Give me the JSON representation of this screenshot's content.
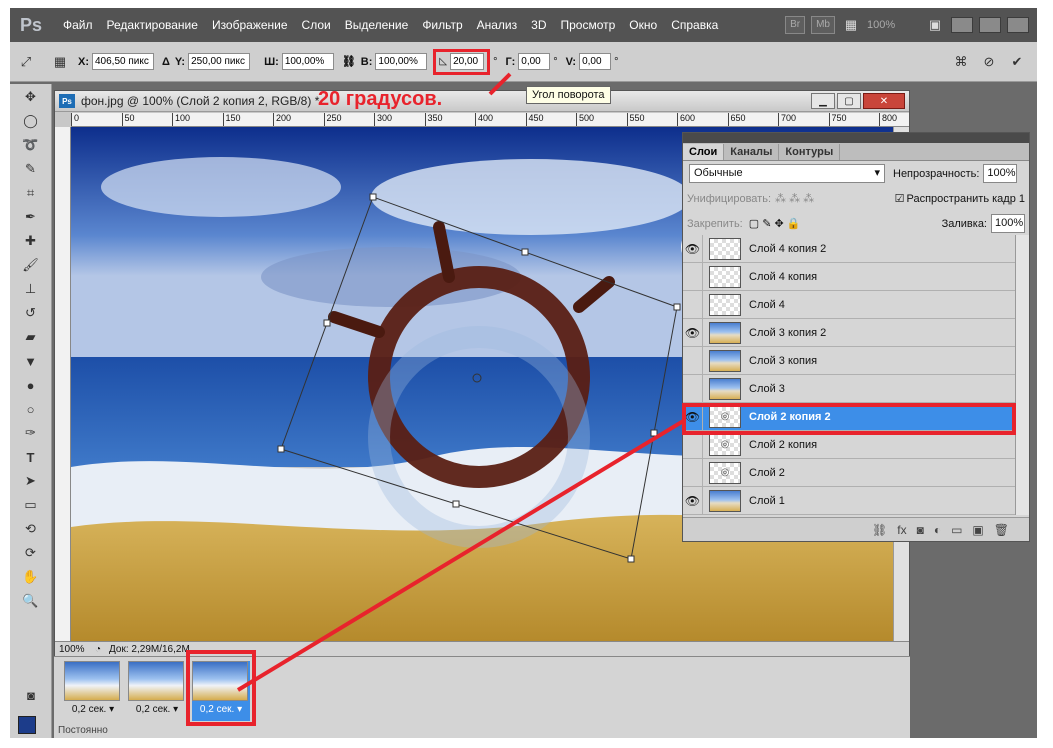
{
  "app": {
    "logo": "Ps"
  },
  "menu": [
    "Файл",
    "Редактирование",
    "Изображение",
    "Слои",
    "Выделение",
    "Фильтр",
    "Анализ",
    "3D",
    "Просмотр",
    "Окно",
    "Справка"
  ],
  "menu_right": {
    "br_label": "Br",
    "mb_label": "Mb",
    "zoom": "100%"
  },
  "options": {
    "x_label": "X:",
    "x_value": "406,50 пикс",
    "y_label": "Y:",
    "y_value": "250,00 пикс",
    "w_label": "Ш:",
    "w_value": "100,00%",
    "h_label": "В:",
    "h_value": "100,00%",
    "angle_value": "20,00",
    "angle_unit": "°",
    "hskew_label": "Г:",
    "hskew_value": "0,00",
    "vskew_label": "V:",
    "vskew_value": "0,00"
  },
  "tooltip": "Угол поворота",
  "annotation": "20 градусов.",
  "document": {
    "title": "фон.jpg @ 100% (Слой 2 копия 2, RGB/8) *",
    "zoom": "100%",
    "status": "Док: 2,29M/16,2M",
    "ruler_marks": [
      "0",
      "50",
      "100",
      "150",
      "200",
      "250",
      "300",
      "350",
      "400",
      "450",
      "500",
      "550",
      "600",
      "650",
      "700",
      "750",
      "800"
    ]
  },
  "animation": {
    "frames": [
      {
        "delay": "0,2 сек.",
        "selected": false
      },
      {
        "delay": "0,2 сек.",
        "selected": false
      },
      {
        "delay": "0,2 сек.",
        "selected": true
      }
    ],
    "loop": "Постоянно"
  },
  "layers_panel": {
    "tabs": [
      "Слои",
      "Каналы",
      "Контуры"
    ],
    "blend_mode": "Обычные",
    "opacity_label": "Непрозрачность:",
    "opacity_value": "100%",
    "unify_label": "Унифицировать:",
    "propagate_label": "Распространить кадр 1",
    "lock_label": "Закрепить:",
    "fill_label": "Заливка:",
    "fill_value": "100%",
    "layers": [
      {
        "name": "Слой 4 копия 2",
        "visible": true,
        "thumb": "transparent",
        "selected": false
      },
      {
        "name": "Слой 4 копия",
        "visible": false,
        "thumb": "transparent",
        "selected": false
      },
      {
        "name": "Слой 4",
        "visible": false,
        "thumb": "transparent",
        "selected": false
      },
      {
        "name": "Слой 3 копия 2",
        "visible": true,
        "thumb": "picture",
        "selected": false
      },
      {
        "name": "Слой 3 копия",
        "visible": false,
        "thumb": "picture",
        "selected": false
      },
      {
        "name": "Слой 3",
        "visible": false,
        "thumb": "picture",
        "selected": false
      },
      {
        "name": "Слой 2 копия 2",
        "visible": true,
        "thumb": "wheel",
        "selected": true
      },
      {
        "name": "Слой 2 копия",
        "visible": false,
        "thumb": "wheel",
        "selected": false
      },
      {
        "name": "Слой 2",
        "visible": false,
        "thumb": "wheel",
        "selected": false
      },
      {
        "name": "Слой 1",
        "visible": true,
        "thumb": "picture",
        "selected": false
      }
    ]
  },
  "colors": {
    "accent_red": "#e8232c",
    "selection_blue": "#3d8ee8"
  }
}
